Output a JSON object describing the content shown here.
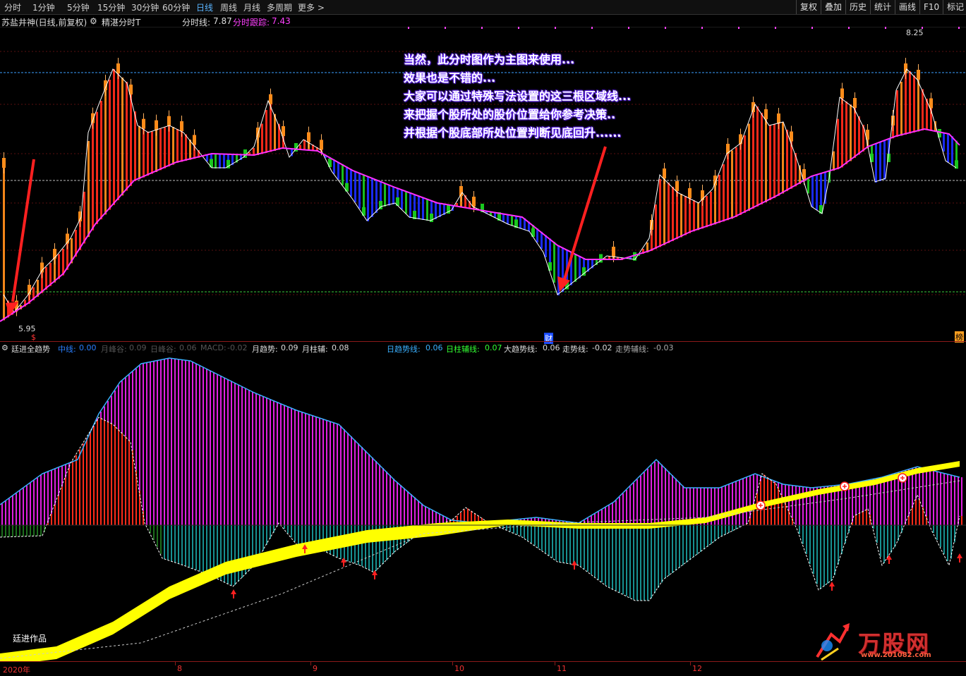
{
  "toolbar": {
    "periods": [
      "分时",
      "1分钟",
      "5分钟",
      "15分钟",
      "30分钟",
      "60分钟",
      "日线",
      "周线",
      "月线",
      "多周期",
      "更多 >"
    ],
    "active_period": "日线",
    "right_buttons": [
      "复权",
      "叠加",
      "历史",
      "统计",
      "画线",
      "F10",
      "标记"
    ]
  },
  "upper_panel": {
    "stock_title": "苏盐井神(日线,前复权)",
    "indicator_name": "精湛分时T",
    "line1_label": "分时线:",
    "line1_value": "7.87",
    "line2_label": "分时跟踪:",
    "line2_value": "7.43",
    "high_price": "8.25",
    "low_price": "5.95",
    "marker_left": "$",
    "marker_mid": "财",
    "marker_right": "榜"
  },
  "annotation": [
    "当然，此分时图作为主图来使用...",
    "效果也是不错的...",
    "大家可以通过特殊写法设置的这三根区域线...",
    "来把握个股所处的股价位置给你参考决策..",
    "并根据个股底部所处位置判断见底回升......"
  ],
  "lower_panel": {
    "indicator_name": "廷进全趋势",
    "values": [
      {
        "label": "中线:",
        "value": "0.00"
      },
      {
        "label": "月峰谷:",
        "value": "0.09"
      },
      {
        "label": "日峰谷:",
        "value": "0.06"
      },
      {
        "label": "MACD:",
        "value": "-0.02"
      },
      {
        "label": "月趋势:",
        "value": "0.09"
      },
      {
        "label": "月柱辅:",
        "value": "0.08"
      },
      {
        "label": "日趋势线:",
        "value": "0.06"
      },
      {
        "label": "日柱辅线:",
        "value": "0.07"
      },
      {
        "label": "大趋势线:",
        "value": "0.06"
      },
      {
        "label": "走势线:",
        "value": "-0.02"
      },
      {
        "label": "走势辅线:",
        "value": "-0.03"
      }
    ],
    "watermark": "廷进作品"
  },
  "x_axis": [
    "2020年",
    "8",
    "9",
    "10",
    "11",
    "12"
  ],
  "logo": {
    "text": "万股网",
    "url_text": "www.201082.com"
  },
  "colors": {
    "up_red": "#ff2a1a",
    "up_orange": "#ff8c1a",
    "down_green": "#19c81e",
    "down_blue": "#1a2cff",
    "ma_magenta": "#ff30ff",
    "trend_yellow": "#ffff00",
    "teal": "#1aa0a0",
    "magenta_bar": "#e020e0"
  }
}
